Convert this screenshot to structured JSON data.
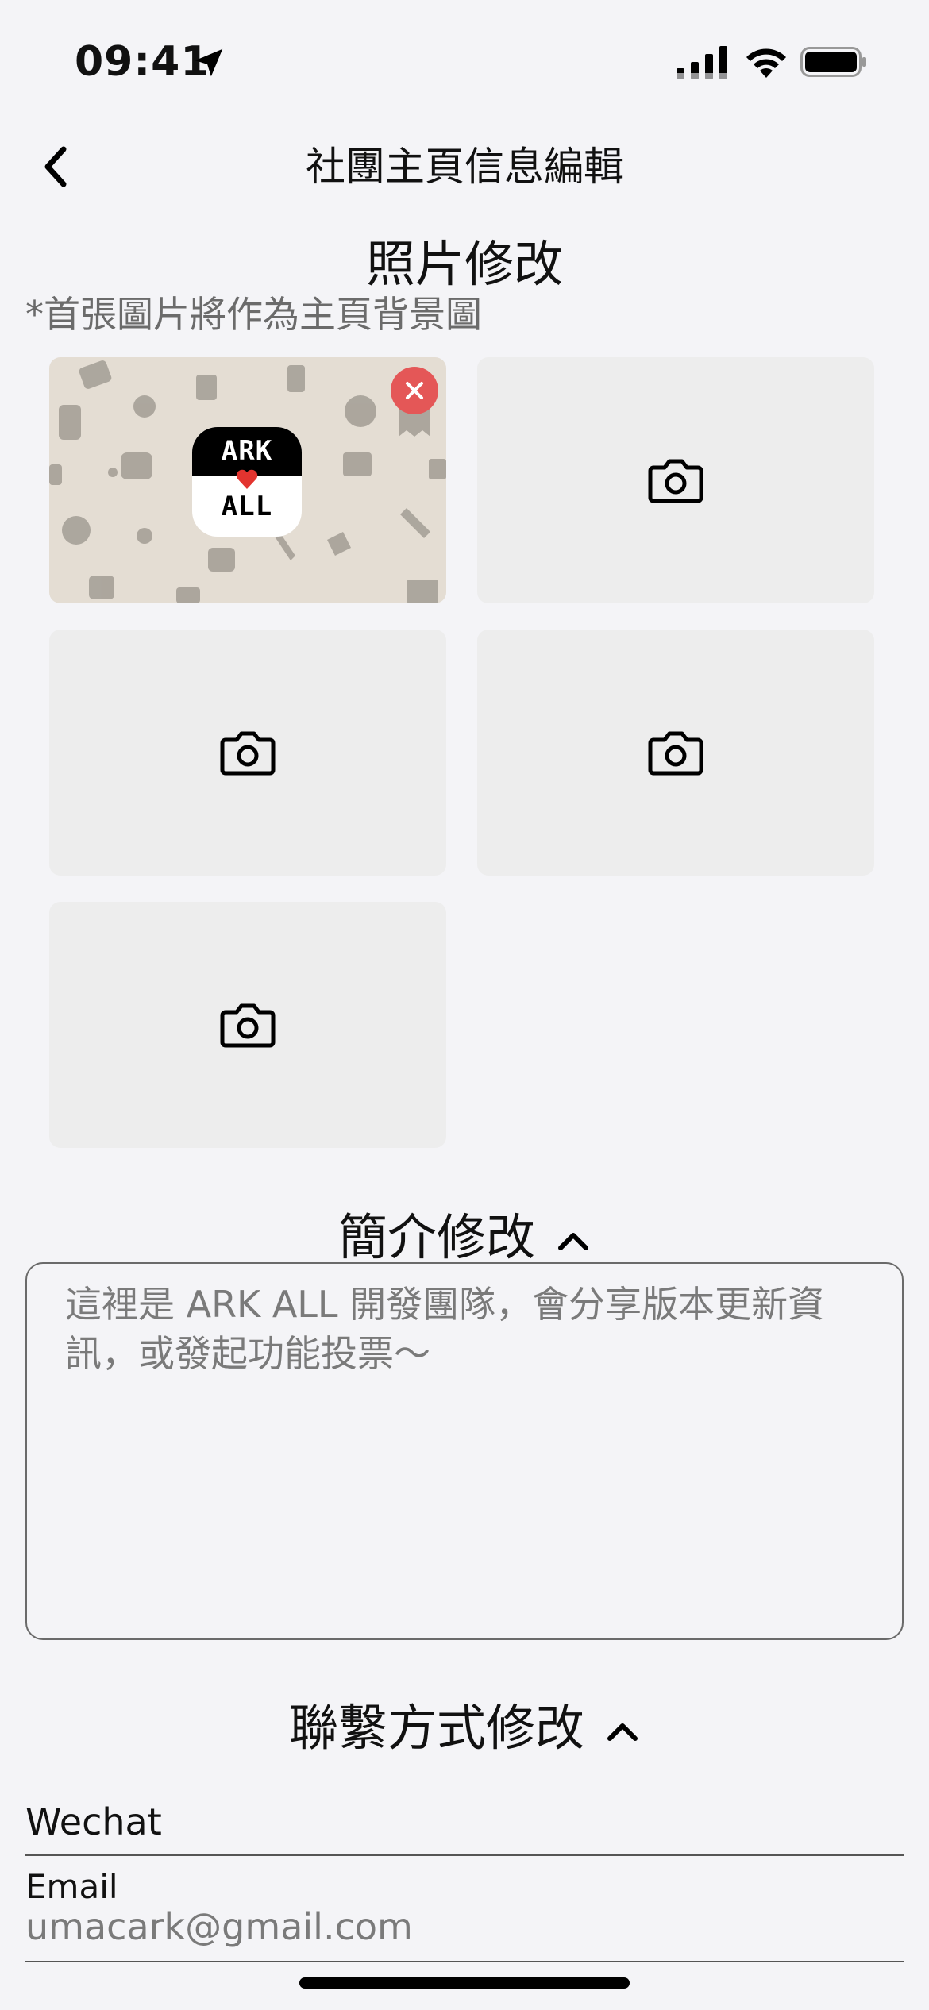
{
  "status_bar": {
    "time": "09:41"
  },
  "nav": {
    "title": "社團主頁信息編輯",
    "back_icon": "chevron-left-icon"
  },
  "photos": {
    "section_title": "照片修改",
    "note": "*首張圖片將作為主頁背景圖",
    "cover": {
      "logo_top_text": "ARK",
      "logo_bottom_text": "ALL",
      "heart_color": "#e3342f",
      "delete_color": "#e45757"
    },
    "empty_slot_icon": "camera-icon",
    "empty_slot_count": 4
  },
  "intro": {
    "section_title": "簡介修改",
    "text": "這裡是 ARK ALL 開發團隊，會分享版本更新資訊，或發起功能投票～"
  },
  "contact": {
    "section_title": "聯繫方式修改",
    "fields": [
      {
        "label": "Wechat",
        "value": ""
      },
      {
        "label": "Email",
        "value": "umacark@gmail.com"
      }
    ]
  }
}
